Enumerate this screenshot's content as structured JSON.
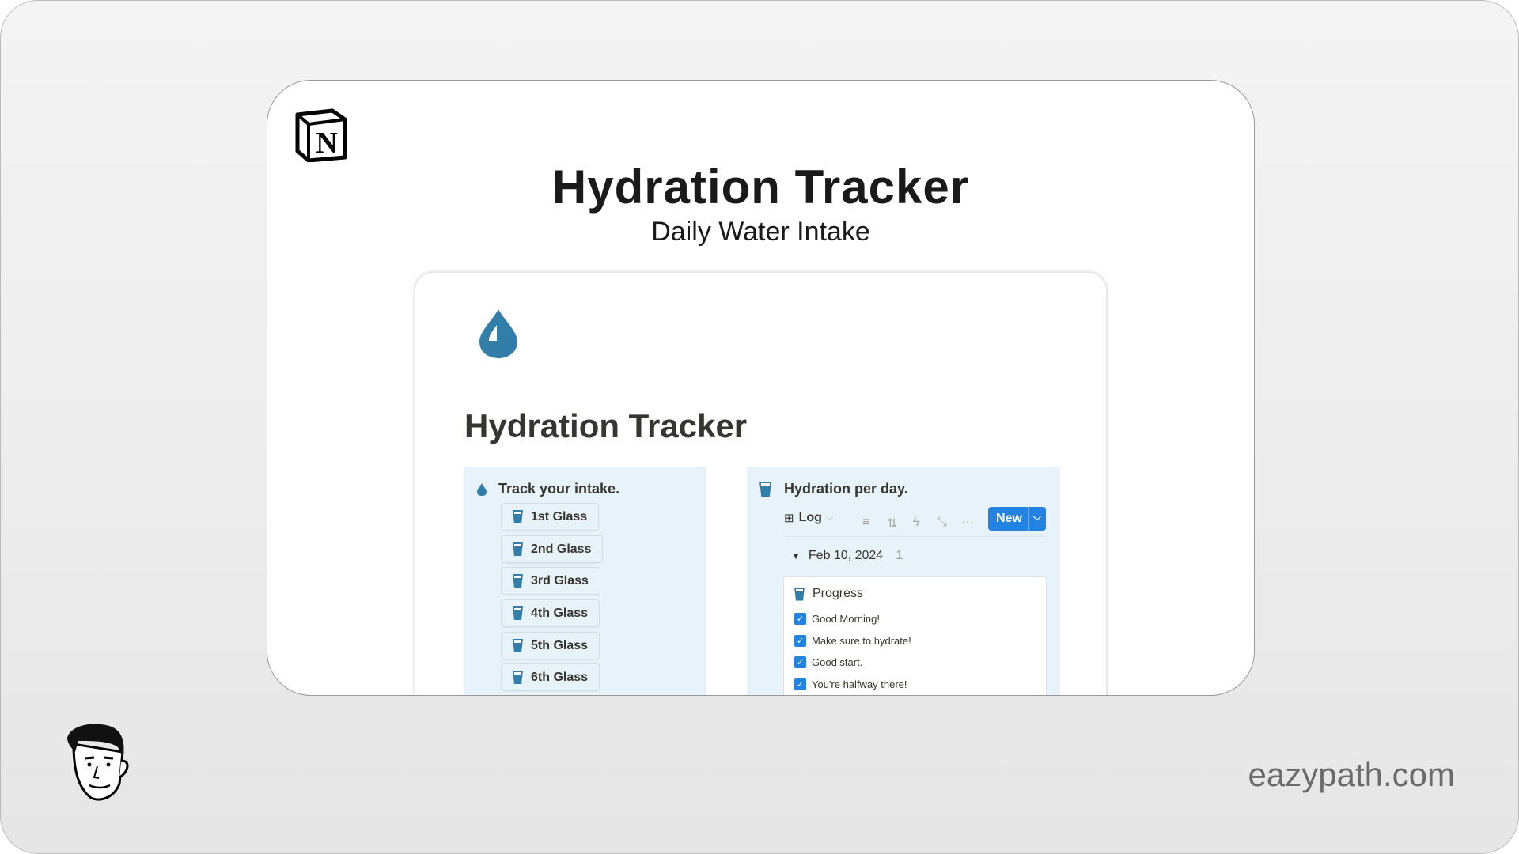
{
  "card": {
    "title": "Hydration Tracker",
    "subtitle": "Daily Water Intake"
  },
  "page": {
    "title": "Hydration Tracker",
    "icon": "water-drop-icon",
    "left_panel": {
      "heading": "Track your intake.",
      "buttons": [
        "1st Glass",
        "2nd Glass",
        "3rd Glass",
        "4th Glass",
        "5th Glass",
        "6th Glass"
      ]
    },
    "right_panel": {
      "heading": "Hydration per day.",
      "view_label": "Log",
      "new_label": "New",
      "group": {
        "date": "Feb 10, 2024",
        "count": "1"
      },
      "card": {
        "title": "Progress",
        "items": [
          {
            "label": "Good Morning!",
            "checked": true
          },
          {
            "label": "Make sure to hydrate!",
            "checked": true
          },
          {
            "label": "Good start.",
            "checked": true
          },
          {
            "label": "You're halfway there!",
            "checked": true
          }
        ]
      }
    }
  },
  "footer": {
    "site": "eazypath.com"
  },
  "colors": {
    "accent": "#2383e2",
    "panel_bg": "#e7f3f8",
    "icon_blue": "#337ea9"
  }
}
